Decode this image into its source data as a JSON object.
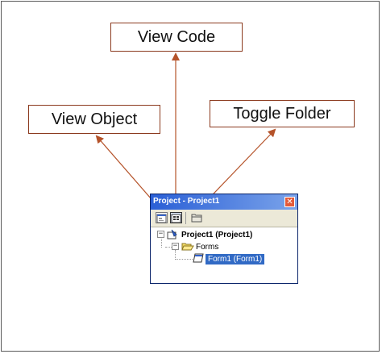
{
  "callouts": {
    "view_code": "View Code",
    "view_object": "View Object",
    "toggle_folder": "Toggle Folder"
  },
  "window": {
    "title": "Project - Project1",
    "close_glyph": "✕",
    "toolbar": [
      {
        "name": "view-object-button",
        "icon": "view-object-icon"
      },
      {
        "name": "view-code-button",
        "icon": "view-code-icon"
      },
      {
        "name": "toggle-folders-button",
        "icon": "folder-icon"
      }
    ],
    "tree": {
      "project": {
        "label": "Project1 (Project1)",
        "expander": "−"
      },
      "forms": {
        "label": "Forms",
        "expander": "−"
      },
      "form1": {
        "label": "Form1 (Form1)",
        "selected": true
      }
    }
  },
  "colors": {
    "arrow": "#b5532a",
    "titlebar": "#2a5fd6",
    "selection": "#316ac5"
  }
}
